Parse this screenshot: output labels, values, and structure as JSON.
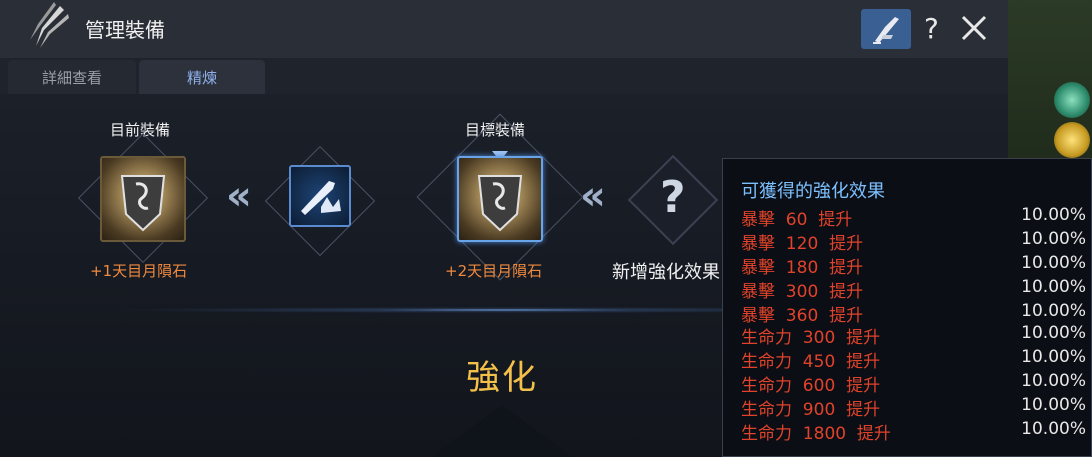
{
  "window": {
    "title": "管理裝備"
  },
  "header": {
    "help_label": "?"
  },
  "tabs": [
    {
      "label": "詳細查看",
      "active": false
    },
    {
      "label": "精煉",
      "active": true
    }
  ],
  "current": {
    "label": "目前裝備",
    "stone": "+1天目月隕石"
  },
  "target": {
    "label": "目標裝備",
    "stone": "+2天目月隕石"
  },
  "unknown": {
    "label": "新增強化效果"
  },
  "action": {
    "label": "強化"
  },
  "tooltip": {
    "title": "可獲得的強化效果",
    "rows": [
      {
        "stat": "暴擊  60  提升",
        "value": "10.00%"
      },
      {
        "stat": "暴擊  120  提升",
        "value": "10.00%"
      },
      {
        "stat": "暴擊  180  提升",
        "value": "10.00%"
      },
      {
        "stat": "暴擊  300  提升",
        "value": "10.00%"
      },
      {
        "stat": "暴擊  360  提升",
        "value": "10.00%"
      },
      {
        "stat": "生命力  300  提升",
        "value": "10.00%"
      },
      {
        "stat": "生命力  450  提升",
        "value": "10.00%"
      },
      {
        "stat": "生命力  600  提升",
        "value": "10.00%"
      },
      {
        "stat": "生命力  900  提升",
        "value": "10.00%"
      },
      {
        "stat": "生命力  1800  提升",
        "value": "10.00%"
      }
    ]
  },
  "icons": {
    "logo": "sword-feather-icon",
    "header_button": "pen-feather-icon",
    "help": "question-icon",
    "close": "close-icon",
    "material": "sword-crystal-icon",
    "unknown": "question-icon"
  },
  "colors": {
    "accent_blue": "#5a8bd0",
    "stone_orange": "#f08a3e",
    "enhance_gold": "#f3c04a",
    "tooltip_title": "#7cc0ff",
    "stat_red": "#e0432b"
  }
}
